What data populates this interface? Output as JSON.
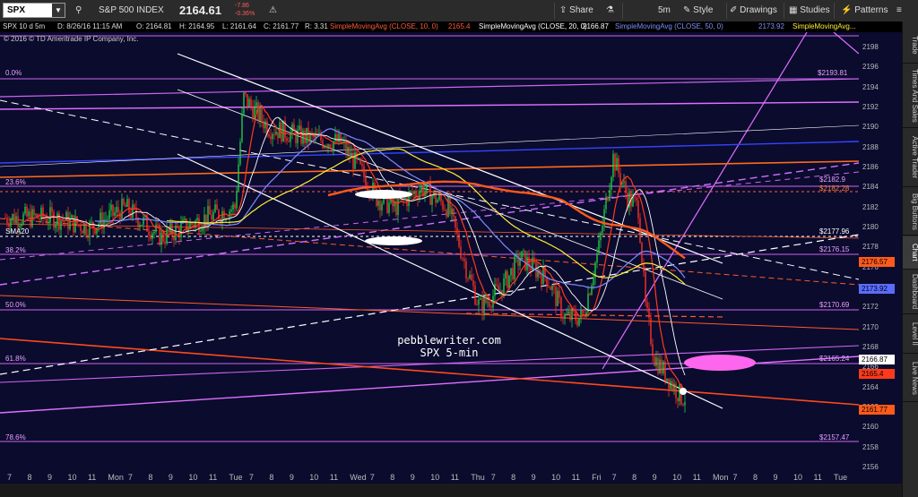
{
  "toolbar": {
    "symbol": "SPX",
    "name": "S&P 500 INDEX",
    "last": "2164.61",
    "change": "-7.86",
    "change_pct": "-0.36%",
    "share": "Share",
    "interval": "5m",
    "style": "Style",
    "drawings": "Drawings",
    "studies": "Studies",
    "patterns": "Patterns"
  },
  "infobar": {
    "chart_id": "SPX 10 d 5m",
    "date": "D: 8/26/16 11:15 AM",
    "open": "O: 2164.81",
    "high": "H: 2164.95",
    "low": "L: 2161.64",
    "close": "C: 2161.77",
    "range": "R: 3.31",
    "sma10": "SimpleMovingAvg (CLOSE, 10, 0)",
    "sma10_val": "2165.4",
    "sma20": "SimpleMovingAvg (CLOSE, 20, 0)",
    "sma20_val": "2166.87",
    "sma50": "SimpleMovingAvg (CLOSE, 50, 0)",
    "sma50_val": "2173.92",
    "sma_more": "SimpleMovingAvg...",
    "copyright": "2016 © TD Ameritrade IP Company, Inc."
  },
  "chart_data": {
    "type": "candlestick",
    "y_ticks": [
      "2198",
      "2196",
      "2194",
      "2192",
      "2190",
      "2188",
      "2186",
      "2184",
      "2182",
      "2180",
      "2178",
      "2176",
      "2174",
      "2172",
      "2170",
      "2168",
      "2166",
      "2164",
      "2162",
      "2160",
      "2158",
      "2156"
    ],
    "ylim": [
      2155,
      2199
    ],
    "x_ticks": [
      "7",
      "8",
      "9",
      "10",
      "11",
      "Mon",
      "7",
      "8",
      "9",
      "10",
      "11",
      "Tue",
      "7",
      "8",
      "9",
      "10",
      "11",
      "Wed",
      "7",
      "8",
      "9",
      "10",
      "11",
      "Thu",
      "7",
      "8",
      "9",
      "10",
      "11",
      "Fri",
      "7",
      "8",
      "9",
      "10",
      "11",
      "Mon",
      "7",
      "8",
      "9",
      "10",
      "11",
      "Tue"
    ],
    "price_tags": [
      {
        "value": "2176.57",
        "color": "#ff5a1a"
      },
      {
        "value": "2173.92",
        "color": "#5a6cff"
      },
      {
        "value": "2166.87",
        "color": "#ffffff"
      },
      {
        "value": "2165.4",
        "color": "#ff3a1a"
      },
      {
        "value": "2161.77",
        "color": "#ff5a1a"
      }
    ],
    "fib_levels": [
      {
        "label": "0.0%",
        "value": "$2193.81"
      },
      {
        "label": "23.6%",
        "value": "$2182.9"
      },
      {
        "label": "38.2%",
        "value": "$2176.15"
      },
      {
        "label": "50.0%",
        "value": "$2170.69"
      },
      {
        "label": "61.8%",
        "value": "$2165.24"
      },
      {
        "label": "78.6%",
        "value": "$2157.47"
      }
    ],
    "sma_label": "SMA20",
    "sma_value": "$2177.96",
    "second_23": "$2182.28"
  },
  "watermark": {
    "line1": "pebblewriter.com",
    "line2": "SPX 5-min"
  },
  "sidebar_tabs": [
    "Trade",
    "Times And Sales",
    "Active Trader",
    "Big Buttons",
    "Chart",
    "Dashboard",
    "Level II",
    "Live News"
  ]
}
